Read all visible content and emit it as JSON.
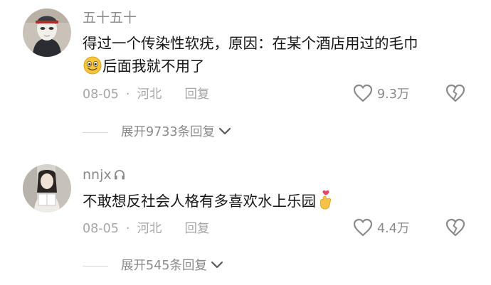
{
  "comments": [
    {
      "username": "五十五十",
      "text_line1": "得过一个传染性软疣，原因：在某个酒店用过的毛巾",
      "text_line2": "后面我就不用了",
      "date": "08-05",
      "dot": "·",
      "location": "河北",
      "reply_label": "回复",
      "likes": "9.3万",
      "expand_label": "展开9733条回复",
      "leading_emoji": "grinning-face-emoji",
      "avatar": "masked-figure-avatar"
    },
    {
      "username": "nnjx",
      "username_icon": "headphones-icon",
      "text_line1": "不敢想反社会人格有多喜欢水上乐园",
      "date": "08-05",
      "dot": "·",
      "location": "河北",
      "reply_label": "回复",
      "likes": "4.4万",
      "expand_label": "展开545条回复",
      "trailing_emoji": "hand-with-heart-emoji",
      "avatar": "girl-with-book-avatar"
    }
  ],
  "colors": {
    "meta_gray": "#a6a6a6",
    "text": "#161616",
    "heart_stroke": "#8a8a8a",
    "emoji_yellow": "#f7c53c",
    "finger_heart": "#e8456b"
  }
}
